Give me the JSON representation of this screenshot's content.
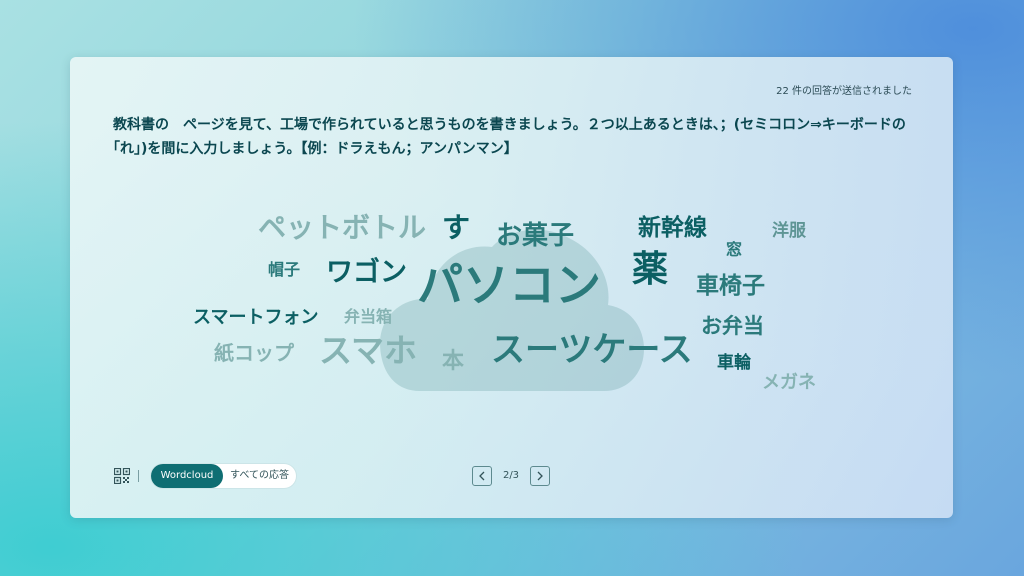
{
  "header": {
    "responses_text": "22 件の回答が送信されました",
    "question": "教科書の　ページを見て、工場で作られていると思うものを書きましょう。２つ以上あるときは、；(セミコロン⇒キーボードの｢れ｣)を間に入力しましょう。【例：ドラえもん；アンパンマン】"
  },
  "wordcloud": {
    "words": [
      {
        "text": "ペットボトル"
      },
      {
        "text": "す"
      },
      {
        "text": "お菓子"
      },
      {
        "text": "新幹線"
      },
      {
        "text": "洋服"
      },
      {
        "text": "窓"
      },
      {
        "text": "帽子"
      },
      {
        "text": "ワゴン"
      },
      {
        "text": "パソコン"
      },
      {
        "text": "薬"
      },
      {
        "text": "車椅子"
      },
      {
        "text": "スマートフォン"
      },
      {
        "text": "弁当箱"
      },
      {
        "text": "お弁当"
      },
      {
        "text": "紙コップ"
      },
      {
        "text": "スマホ"
      },
      {
        "text": "本"
      },
      {
        "text": "スーツケース"
      },
      {
        "text": "車輪"
      },
      {
        "text": "メガネ"
      }
    ]
  },
  "footer": {
    "qr_icon": "qr-code-icon",
    "tab_wordcloud": "Wordcloud",
    "tab_all": "すべての応答",
    "page_label": "2/3"
  },
  "colors": {
    "accent": "#0f6e73",
    "text": "#0b4750"
  }
}
